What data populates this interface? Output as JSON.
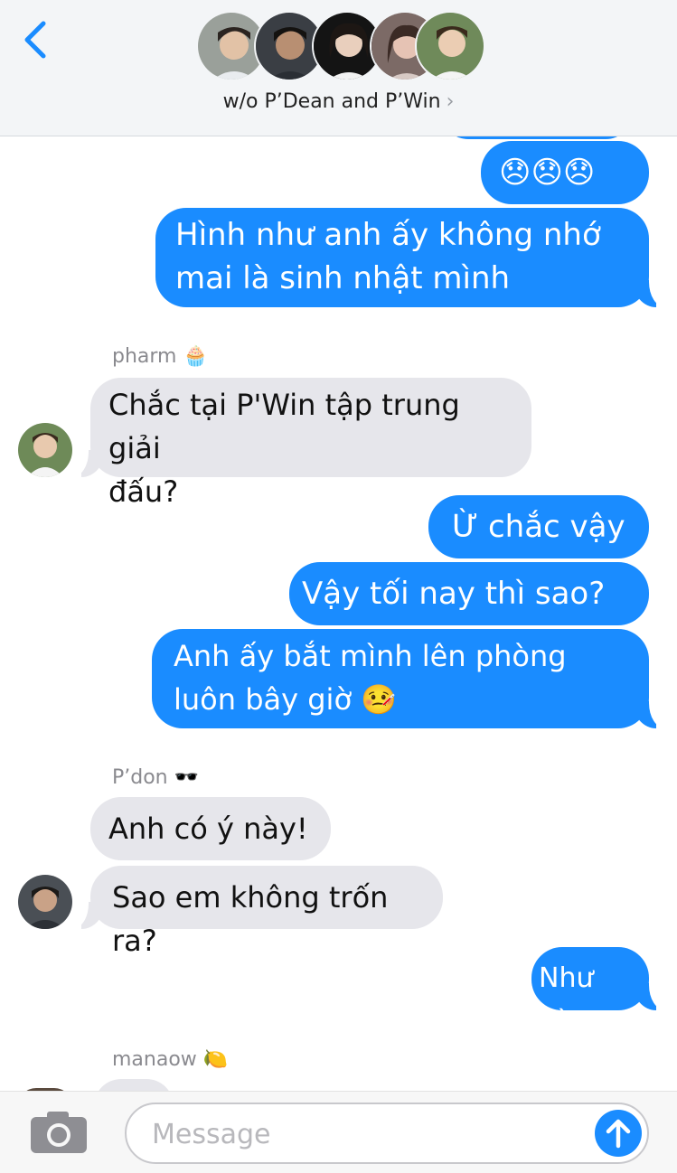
{
  "header": {
    "back_icon": "chevron-left-icon",
    "group_name": "w/o P’Dean and P’Win",
    "chevron": "›",
    "accent": "#1a8cff"
  },
  "messages": {
    "m1": "😞😞😞",
    "m2_line1": "Hình như anh ấy không nhớ",
    "m2_line2": "mai là sinh nhật mình",
    "sender_pharm": "pharm 🧁",
    "m3_line1": "Chắc tại P'Win tập trung giải",
    "m3_line2": "đấu?",
    "m4": "Ừ chắc vậy",
    "m5": "Vậy tối nay thì sao?",
    "m6_line1": "Anh ấy bắt mình lên phòng",
    "m6_line2": "luôn bây giờ 🤒",
    "sender_pdon": "P’don 🕶️",
    "m7": "Anh có ý này!",
    "m8": "Sao em không trốn ra?",
    "m9": "Như nào",
    "sender_manaow": "manaow 🍋"
  },
  "compose": {
    "camera_icon": "camera-icon",
    "placeholder": "Message",
    "send_icon": "arrow-up-icon"
  }
}
